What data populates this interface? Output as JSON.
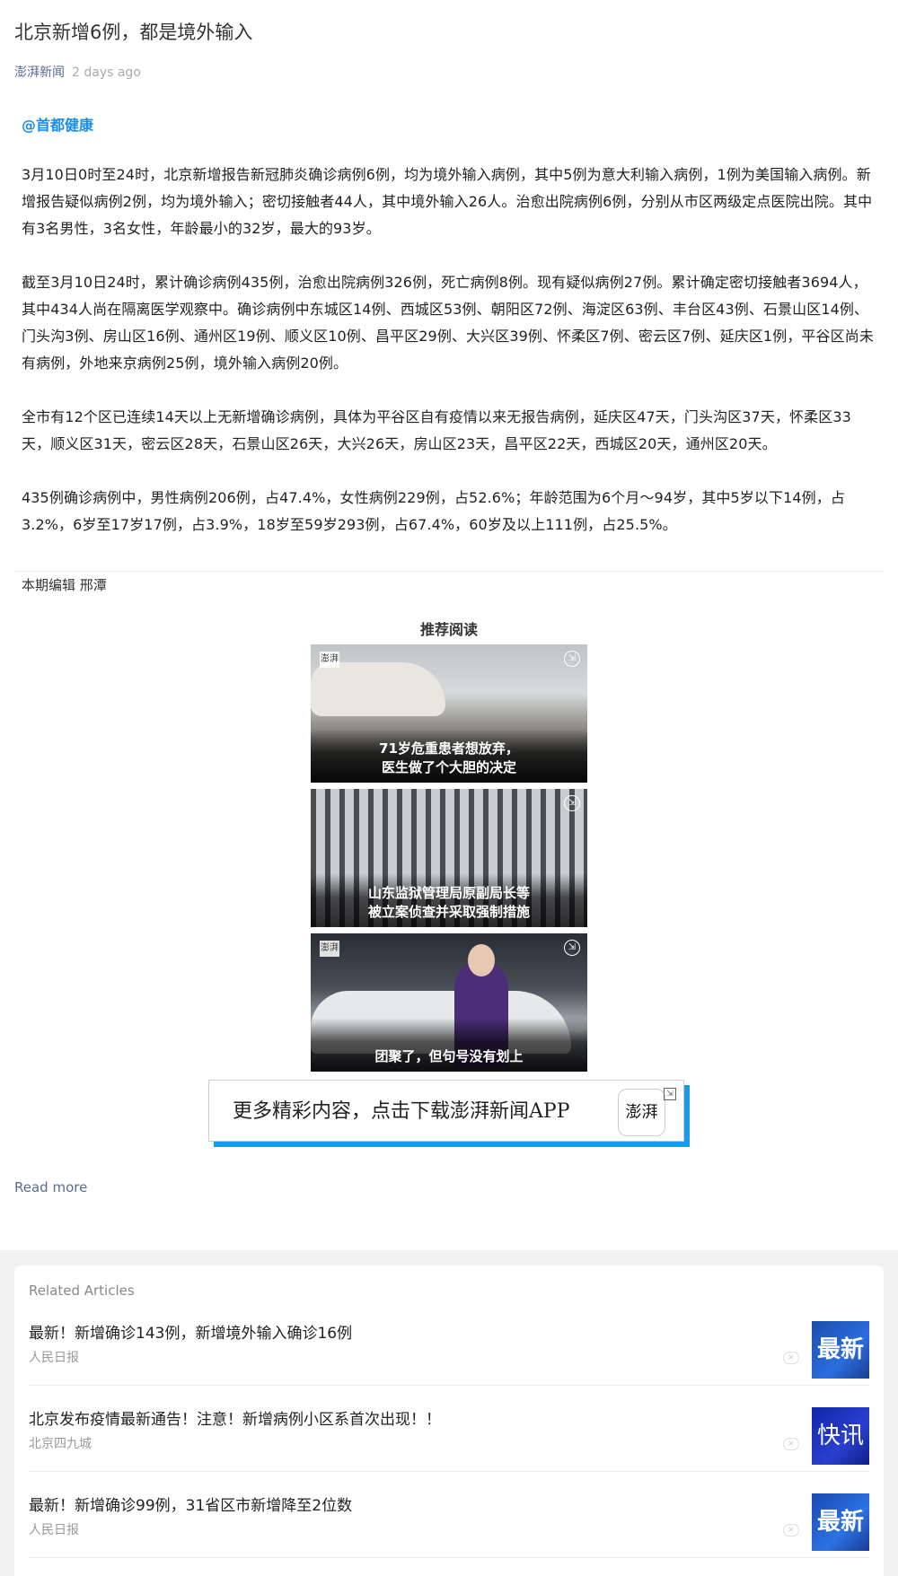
{
  "article": {
    "title": "北京新增6例，都是境外输入",
    "source": "澎湃新闻",
    "time": "2 days ago",
    "mention": "@首都健康",
    "paragraphs": [
      "3月10日0时至24时，北京新增报告新冠肺炎确诊病例6例，均为境外输入病例，其中5例为意大利输入病例，1例为美国输入病例。新增报告疑似病例2例，均为境外输入；密切接触者44人，其中境外输入26人。治愈出院病例6例，分别从市区两级定点医院出院。其中有3名男性，3名女性，年龄最小的32岁，最大的93岁。",
      "截至3月10日24时，累计确诊病例435例，治愈出院病例326例，死亡病例8例。现有疑似病例27例。累计确定密切接触者3694人，其中434人尚在隔离医学观察中。确诊病例中东城区14例、西城区53例、朝阳区72例、海淀区63例、丰台区43例、石景山区14例、门头沟3例、房山区16例、通州区19例、顺义区10例、昌平区29例、大兴区39例、怀柔区7例、密云区7例、延庆区1例，平谷区尚未有病例，外地来京病例25例，境外输入病例20例。",
      "全市有12个区已连续14天以上无新增确诊病例，具体为平谷区自有疫情以来无报告病例，延庆区47天，门头沟区37天，怀柔区33天，顺义区31天，密云区28天，石景山区26天，大兴26天，房山区23天，昌平区22天，西城区20天，通州区20天。",
      "435例确诊病例中，男性病例206例，占47.4%，女性病例229例，占52.6%；年龄范围为6个月～94岁，其中5岁以下14例，占3.2%，6岁至17岁17例，占3.9%，18岁至59岁293例，占67.4%，60岁及以上111例，占25.5%。"
    ],
    "editor": "本期编辑 邢潭"
  },
  "recommend": {
    "title": "推荐阅读",
    "items": [
      {
        "caption_line1": "71岁危重患者想放弃，",
        "caption_line2": "医生做了个大胆的决定"
      },
      {
        "caption_line1": "山东监狱管理局原副局长等",
        "caption_line2": "被立案侦查并采取强制措施"
      },
      {
        "caption_line1": "团聚了，但句号没有划上",
        "caption_line2": ""
      }
    ],
    "watermark": "澎湃"
  },
  "banner": {
    "text": "更多精彩内容，点击下载澎湃新闻APP",
    "logo": "澎湃"
  },
  "read_more": "Read more",
  "related": {
    "title": "Related Articles",
    "items": [
      {
        "headline": "最新！新增确诊143例，新增境外输入确诊16例",
        "source": "人民日报",
        "thumb": "最新"
      },
      {
        "headline": "北京发布疫情最新通告！注意！新增病例小区系首次出现！！",
        "source": "北京四九城",
        "thumb": "快讯"
      },
      {
        "headline": "最新！新增确诊99例，31省区市新增降至2位数",
        "source": "人民日报",
        "thumb": "最新"
      }
    ]
  },
  "icons": {
    "ad": "ad-badge-icon",
    "close": "close-icon"
  }
}
